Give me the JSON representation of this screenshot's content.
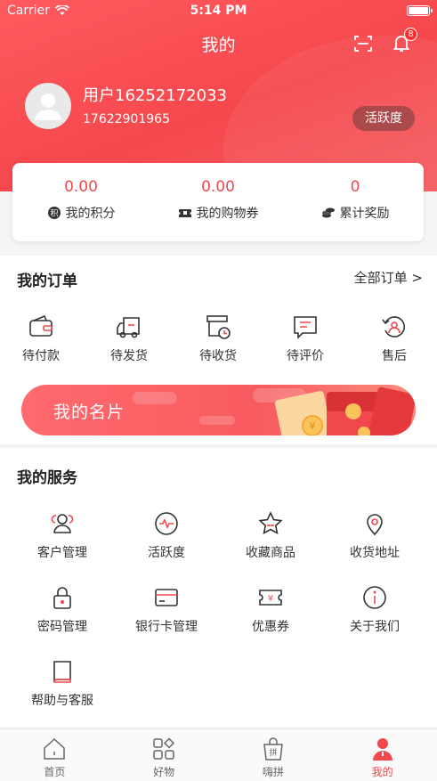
{
  "status_bar": {
    "carrier": "Carrier",
    "time": "5:14 PM"
  },
  "header": {
    "title": "我的",
    "notification_count": "8"
  },
  "profile": {
    "username": "用户16252172033",
    "phone": "17622901965",
    "activity_button": "活跃度"
  },
  "stats": [
    {
      "value": "0.00",
      "label": "我的积分",
      "icon": "points-icon"
    },
    {
      "value": "0.00",
      "label": "我的购物券",
      "icon": "ticket-icon"
    },
    {
      "value": "0",
      "label": "累计奖励",
      "icon": "coins-icon"
    }
  ],
  "orders": {
    "title": "我的订单",
    "all_link": "全部订单 >",
    "items": [
      {
        "label": "待付款",
        "icon": "wallet-icon"
      },
      {
        "label": "待发货",
        "icon": "truck-icon"
      },
      {
        "label": "待收货",
        "icon": "box-clock-icon"
      },
      {
        "label": "待评价",
        "icon": "comment-icon"
      },
      {
        "label": "售后",
        "icon": "refund-icon"
      }
    ]
  },
  "card_banner": {
    "label": "我的名片"
  },
  "services": {
    "title": "我的服务",
    "items": [
      {
        "label": "客户管理",
        "icon": "users-icon"
      },
      {
        "label": "活跃度",
        "icon": "pulse-icon"
      },
      {
        "label": "收藏商品",
        "icon": "star-icon"
      },
      {
        "label": "收货地址",
        "icon": "location-icon"
      },
      {
        "label": "密码管理",
        "icon": "lock-icon"
      },
      {
        "label": "银行卡管理",
        "icon": "card-icon"
      },
      {
        "label": "优惠券",
        "icon": "coupon-icon"
      },
      {
        "label": "关于我们",
        "icon": "info-icon"
      },
      {
        "label": "帮助与客服",
        "icon": "book-icon"
      }
    ]
  },
  "tabs": [
    {
      "label": "首页",
      "icon": "home-icon"
    },
    {
      "label": "好物",
      "icon": "grid-icon"
    },
    {
      "label": "嗨拼",
      "icon": "bag-icon"
    },
    {
      "label": "我的",
      "icon": "profile-icon",
      "active": true
    }
  ],
  "colors": {
    "brand": "#f0484d",
    "text": "#333333",
    "background": "#f5f5f5"
  }
}
